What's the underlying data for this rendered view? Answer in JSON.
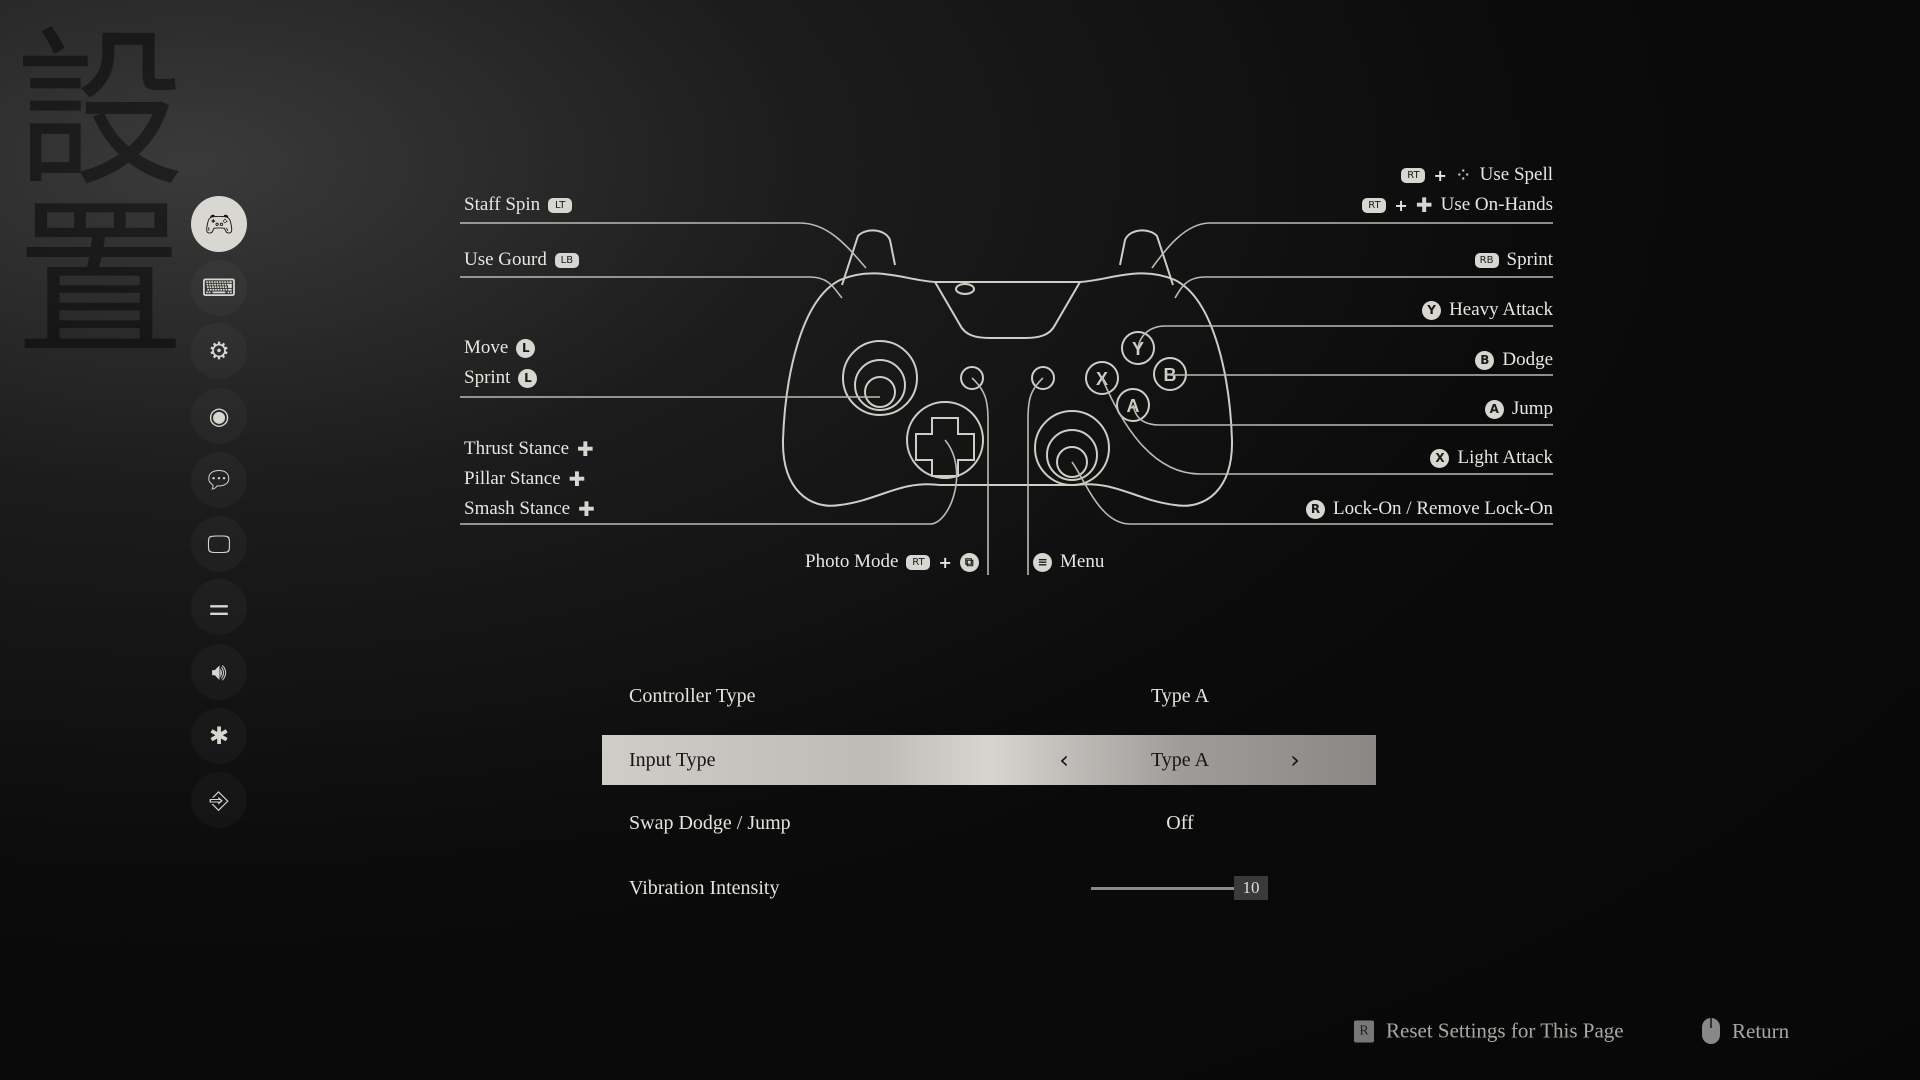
{
  "background_glyphs": "設置",
  "sidebar": {
    "items": [
      {
        "icon": "gamepad-icon",
        "glyph": "🎮︎",
        "active": true
      },
      {
        "icon": "mouse-keyboard-icon",
        "glyph": "⌨",
        "active": false
      },
      {
        "icon": "gear-icon",
        "glyph": "⚙",
        "active": false
      },
      {
        "icon": "eye-icon",
        "glyph": "◉",
        "active": false
      },
      {
        "icon": "chat-icon",
        "glyph": "💬︎",
        "active": false
      },
      {
        "icon": "monitor-icon",
        "glyph": "🖵",
        "active": false
      },
      {
        "icon": "sliders-icon",
        "glyph": "⚌",
        "active": false
      },
      {
        "icon": "speaker-icon",
        "glyph": "🔊︎",
        "active": false
      },
      {
        "icon": "accessibility-icon",
        "glyph": "✱",
        "active": false
      },
      {
        "icon": "exit-icon",
        "glyph": "⎆",
        "active": false
      }
    ]
  },
  "controller_map": {
    "left": [
      {
        "label": "Staff Spin",
        "keys": [
          "LT"
        ]
      },
      {
        "label": "Use Gourd",
        "keys": [
          "LB"
        ]
      },
      {
        "label": "Move",
        "keys": [
          "L"
        ]
      },
      {
        "label": "Sprint",
        "keys": [
          "L"
        ]
      },
      {
        "label": "Thrust Stance",
        "keys": [
          "✚"
        ]
      },
      {
        "label": "Pillar Stance",
        "keys": [
          "✚"
        ]
      },
      {
        "label": "Smash Stance",
        "keys": [
          "✚"
        ]
      }
    ],
    "right": [
      {
        "label": "Use Spell",
        "keys": [
          "RT",
          "+",
          "⁘"
        ]
      },
      {
        "label": "Use On-Hands",
        "keys": [
          "RT",
          "+",
          "✚"
        ]
      },
      {
        "label": "Sprint",
        "keys": [
          "RB"
        ]
      },
      {
        "label": "Heavy Attack",
        "keys": [
          "Y"
        ]
      },
      {
        "label": "Dodge",
        "keys": [
          "B"
        ]
      },
      {
        "label": "Jump",
        "keys": [
          "A"
        ]
      },
      {
        "label": "Light Attack",
        "keys": [
          "X"
        ]
      },
      {
        "label": "Lock-On / Remove Lock-On",
        "keys": [
          "R"
        ]
      }
    ],
    "bottom": [
      {
        "label": "Photo Mode",
        "keys": [
          "RT",
          "+",
          "⧉"
        ]
      },
      {
        "label": "Menu",
        "keys": [
          "≡"
        ]
      }
    ],
    "face_buttons": [
      "Y",
      "B",
      "X",
      "A"
    ]
  },
  "settings": {
    "rows": [
      {
        "label": "Controller Type",
        "value": "Type A"
      },
      {
        "label": "Input Type",
        "value": "Type A",
        "selected": true,
        "prev": "‹",
        "next": "›"
      },
      {
        "label": "Swap Dodge / Jump",
        "value": "Off"
      },
      {
        "label": "Vibration Intensity",
        "value": "10",
        "slider_percent": 100
      }
    ]
  },
  "footer": {
    "reset_key": "R",
    "reset_label": "Reset Settings for This Page",
    "return_label": "Return"
  }
}
